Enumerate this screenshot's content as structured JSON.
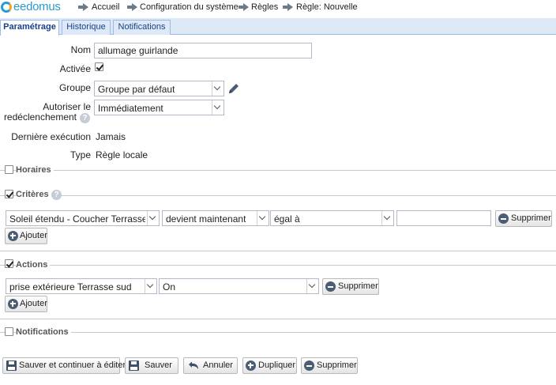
{
  "logo": {
    "text": "eedomus"
  },
  "breadcrumb": [
    {
      "label": "Accueil"
    },
    {
      "label": "Configuration du système"
    },
    {
      "label": "Règles"
    },
    {
      "label": "Règle: Nouvelle"
    }
  ],
  "tabs": [
    {
      "label": "Paramétrage",
      "active": true
    },
    {
      "label": "Historique",
      "active": false
    },
    {
      "label": "Notifications",
      "active": false
    }
  ],
  "form": {
    "name_label": "Nom",
    "name_value": "allumage guirlande",
    "active_label": "Activée",
    "active_checked": true,
    "group_label": "Groupe",
    "group_value": "Groupe par défaut",
    "retrigger_label_line1": "Autoriser le",
    "retrigger_label_line2": "redéclenchement",
    "retrigger_value": "Immédiatement",
    "last_exec_label": "Dernière exécution",
    "last_exec_value": "Jamais",
    "type_label": "Type",
    "type_value": "Règle locale"
  },
  "sections": {
    "horaires": {
      "title": "Horaires",
      "checked": false
    },
    "criteres": {
      "title": "Critères",
      "checked": true,
      "row": {
        "device": "Soleil étendu - Coucher Terrasse sud",
        "condition": "devient maintenant",
        "operator": "égal à",
        "value": ""
      },
      "delete_label": "Supprimer",
      "add_label": "Ajouter"
    },
    "actions": {
      "title": "Actions",
      "checked": true,
      "row": {
        "device": "prise extérieure Terrasse sud",
        "value": "On"
      },
      "delete_label": "Supprimer",
      "add_label": "Ajouter"
    },
    "notifications": {
      "title": "Notifications",
      "checked": false
    }
  },
  "footer_buttons": {
    "save_continue": "Sauver et continuer à éditer",
    "save": "Sauver",
    "cancel": "Annuler",
    "duplicate": "Dupliquer",
    "delete": "Supprimer"
  },
  "colors": {
    "accent": "#2a9bd0",
    "tab_border": "#99bbe8",
    "tab_bg": "#dde8f5",
    "icon_dark": "#4a5d74"
  }
}
